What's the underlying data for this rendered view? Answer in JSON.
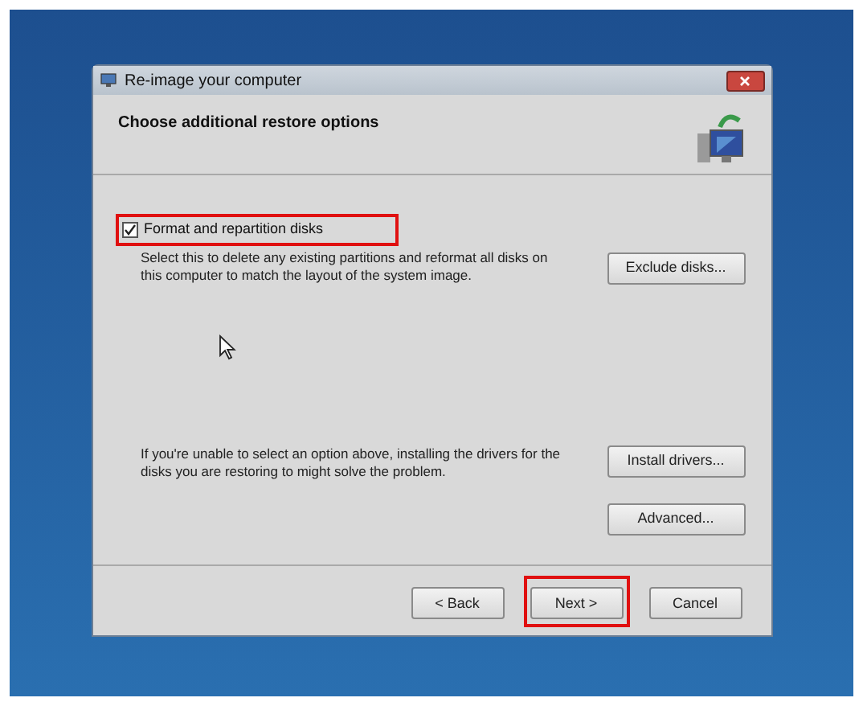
{
  "window": {
    "title": "Re-image your computer"
  },
  "heading": "Choose additional restore options",
  "format_option": {
    "label": "Format and repartition disks",
    "checked": true,
    "highlighted": true,
    "description": "Select this to delete any existing partitions and reformat all disks on this computer to match the layout of the system image.",
    "button": "Exclude disks..."
  },
  "drivers": {
    "description": "If you're unable to select an option above, installing the drivers for the disks you are restoring to might solve the problem.",
    "button": "Install drivers..."
  },
  "advanced_button": "Advanced...",
  "footer_buttons": [
    {
      "label": "< Back",
      "highlighted": false
    },
    {
      "label": "Next >",
      "highlighted": true
    },
    {
      "label": "Cancel",
      "highlighted": false
    }
  ]
}
